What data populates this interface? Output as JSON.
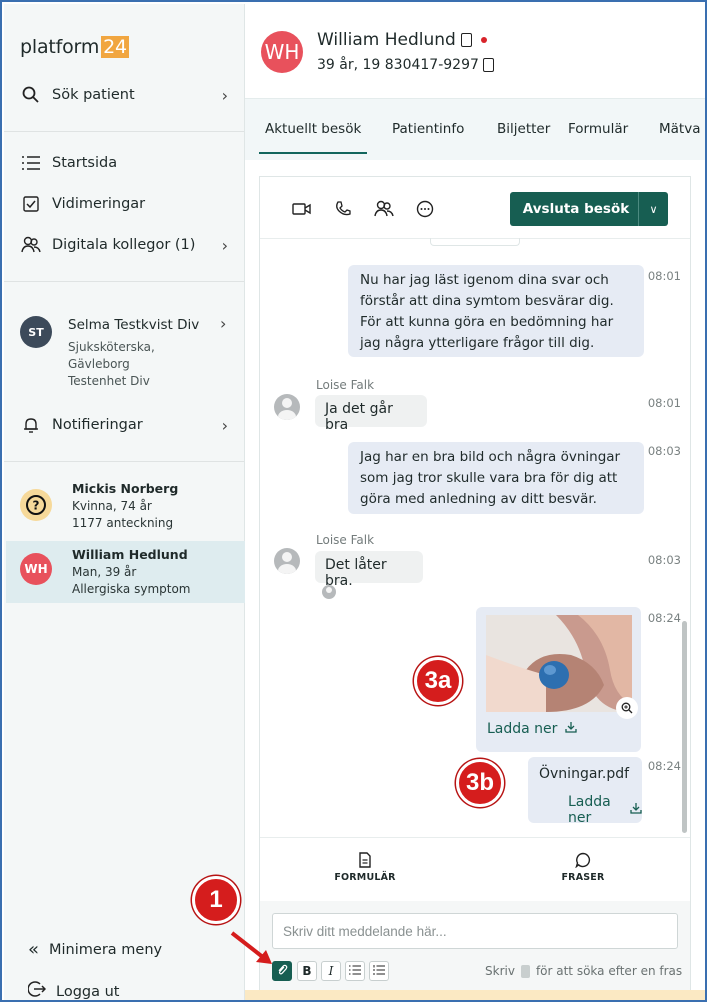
{
  "sidebar": {
    "logo_text": "platform",
    "logo_badge": "24",
    "search_label": "Sök patient",
    "nav": [
      {
        "label": "Startsida"
      },
      {
        "label": "Vidimeringar"
      },
      {
        "label": "Digitala kollegor (1)"
      }
    ],
    "profile": {
      "initials": "ST",
      "name": "Selma Testkvist Div",
      "role": "Sjuksköterska, Gävleborg Testenhet Div"
    },
    "notifications_label": "Notifieringar",
    "patients": [
      {
        "name": "Mickis Norberg",
        "line1": "Kvinna, 74 år",
        "line2": "1177 anteckning"
      },
      {
        "initials": "WH",
        "name": "William Hedlund",
        "line1": "Man, 39 år",
        "line2": "Allergiska symptom"
      }
    ],
    "minimize_label": "Minimera meny",
    "logout_label": "Logga ut"
  },
  "header": {
    "initials": "WH",
    "name": "William Hedlund",
    "subtitle": "39 år, 19 830417-9297"
  },
  "tabs": [
    {
      "label": "Aktuellt besök"
    },
    {
      "label": "Patientinfo"
    },
    {
      "label": "Biljetter"
    },
    {
      "label": "Formulär"
    },
    {
      "label": "Mätva"
    }
  ],
  "toolbar": {
    "end_visit_label": "Avsluta besök"
  },
  "messages": [
    {
      "text": "Nu har jag läst igenom dina svar och förstår att dina symtom besvärar dig. För att kunna göra en bedömning har jag några ytterligare frågor till dig.",
      "time": "08:01"
    },
    {
      "sender": "Loise Falk",
      "text": "Ja det går bra",
      "time": "08:01"
    },
    {
      "text": "Jag har en bra bild och några övningar som jag tror skulle vara bra för dig att göra med anledning av ditt besvär.",
      "time": "08:03"
    },
    {
      "sender": "Loise Falk",
      "text": "Det låter bra.",
      "time": "08:03"
    },
    {
      "time": "08:24",
      "download_label": "Ladda ner"
    },
    {
      "file_name": "Övningar.pdf",
      "time": "08:24",
      "download_label": "Ladda ner"
    }
  ],
  "quick_actions": {
    "forms_label": "FORMULÄR",
    "phrases_label": "FRASER"
  },
  "composer": {
    "placeholder": "Skriv ditt meddelande här...",
    "hint_before": "Skriv",
    "hint_after": "för att söka efter en fras"
  },
  "callouts": {
    "c1": "1",
    "c3a": "3a",
    "c3b": "3b"
  },
  "colors": {
    "primary": "#175e52",
    "avatar_red": "#e8515c",
    "callout_red": "#d51d1d",
    "bubble_out": "#e6ebf4",
    "bubble_in": "#eff1f1"
  }
}
